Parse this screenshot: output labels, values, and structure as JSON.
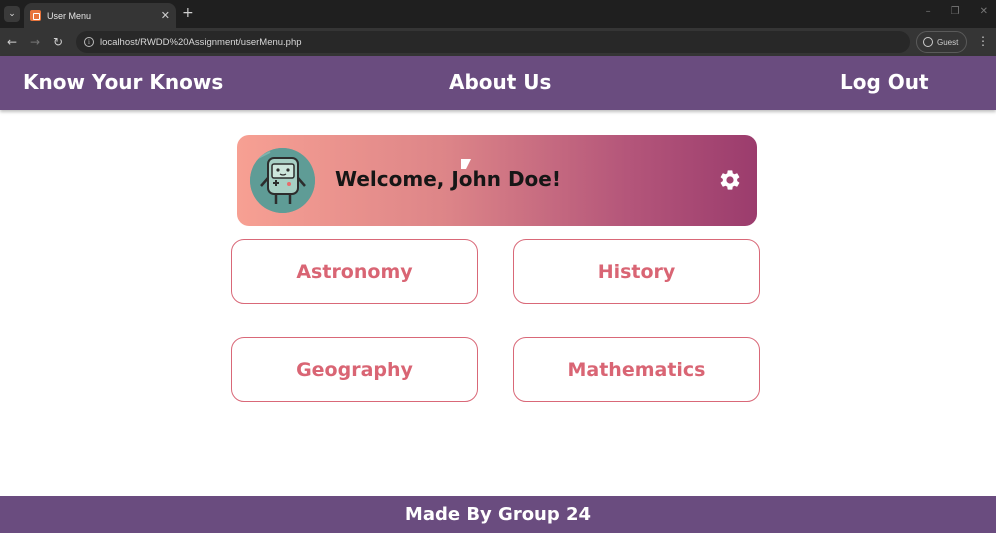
{
  "browser": {
    "tab_title": "User Menu",
    "url": "localhost/RWDD%20Assignment/userMenu.php",
    "profile_label": "Guest"
  },
  "nav": {
    "brand": "Know Your Knows",
    "about": "About Us",
    "logout": "Log Out"
  },
  "welcome": {
    "message": "Welcome, John Doe!"
  },
  "subjects": [
    "Astronomy",
    "History",
    "Geography",
    "Mathematics"
  ],
  "footer": {
    "text": "Made By Group 24"
  },
  "colors": {
    "nav_bg": "#6a4c7f",
    "subject_accent": "#d96574",
    "card_gradient_start": "#f7a093",
    "card_gradient_end": "#9b3c6d"
  }
}
